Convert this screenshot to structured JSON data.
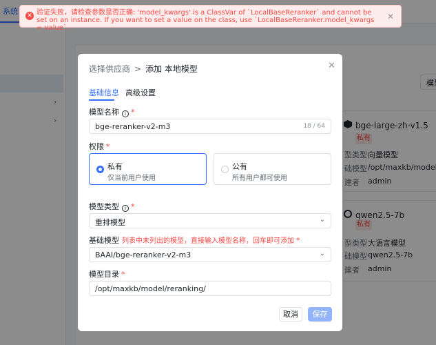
{
  "alert": {
    "text": "验证失败，请检查参数是否正确: 'model_kwargs' is a ClassVar of `LocalBaseReranker` and cannot be set on an instance. If you want to set a value on the class, use `LocalBaseReranker.model_kwargs = value`."
  },
  "background": {
    "top_tab": "系统设",
    "right_button": "模型",
    "cards": [
      {
        "name": "bge-large-zh-v1.5",
        "badge": "私有",
        "rows": [
          {
            "label": "型类型",
            "value": "向量模型"
          },
          {
            "label": "础模型",
            "value": "/opt/maxkb/model/em"
          },
          {
            "label": "建者",
            "value": "admin"
          }
        ]
      },
      {
        "name": "qwen2.5-7b",
        "badge": "私有",
        "rows": [
          {
            "label": "型类型",
            "value": "大语言模型"
          },
          {
            "label": "础模型",
            "value": "qwen2.5-7b"
          },
          {
            "label": "建者",
            "value": "admin"
          }
        ]
      }
    ]
  },
  "dialog": {
    "crumb": "选择供应商",
    "separator": ">",
    "title": "添加 本地模型",
    "tabs": [
      "基础信息",
      "高级设置"
    ],
    "model_name": {
      "label": "模型名称",
      "value": "bge-reranker-v2-m3",
      "count": "18 / 64"
    },
    "permission": {
      "label": "权限",
      "options": [
        {
          "title": "私有",
          "desc": "仅当前用户使用",
          "selected": true
        },
        {
          "title": "公有",
          "desc": "所有用户都可使用",
          "selected": false
        }
      ]
    },
    "model_type": {
      "label": "模型类型",
      "value": "重排模型"
    },
    "base_model": {
      "label": "基础模型",
      "hint": "列表中未列出的模型，直接输入模型名称，回车即可添加",
      "value": "BAAI/bge-reranker-v2-m3"
    },
    "model_dir": {
      "label": "模型目录",
      "value": "/opt/maxkb/model/reranking/"
    },
    "cancel_label": "取消",
    "save_label": "保存"
  },
  "colors": {
    "primary": "#3370ff",
    "error": "#f54a45",
    "save_disabled": "#92b4fc"
  }
}
